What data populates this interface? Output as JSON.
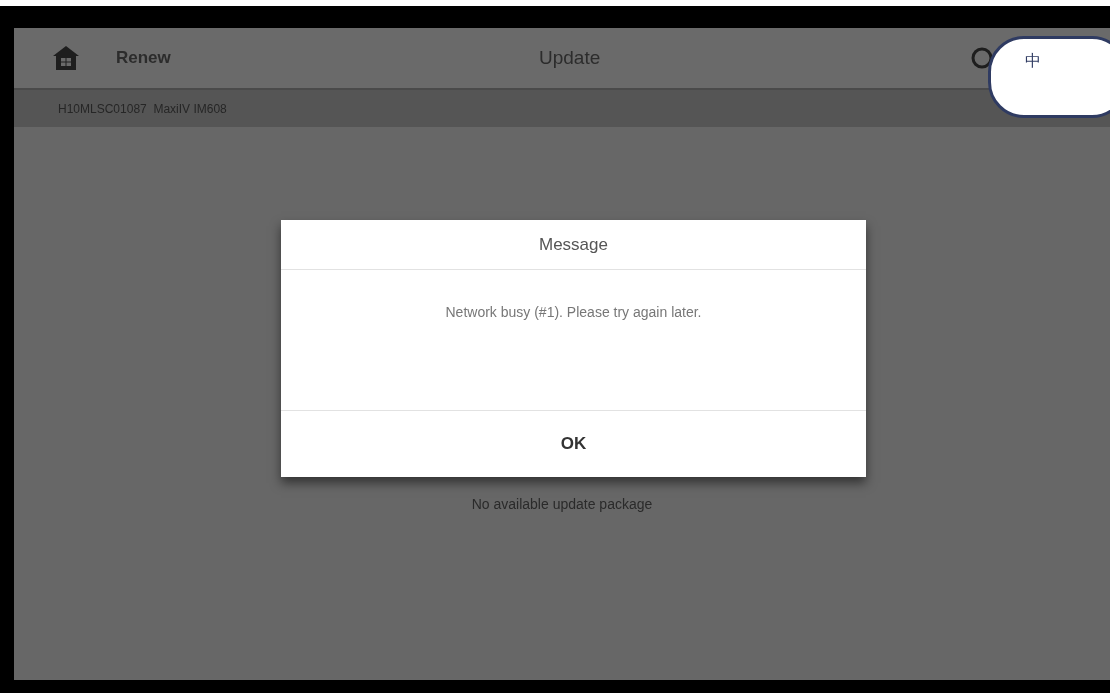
{
  "header": {
    "back_label": "Renew",
    "title": "Update"
  },
  "device_bar": {
    "text": "H10MLSC01087  MaxiIV IM608"
  },
  "body": {
    "status": "No available update package"
  },
  "dialog": {
    "title": "Message",
    "message": "Network busy (#1). Please try again later.",
    "button": "OK"
  },
  "input_widget": {
    "label": "中"
  }
}
